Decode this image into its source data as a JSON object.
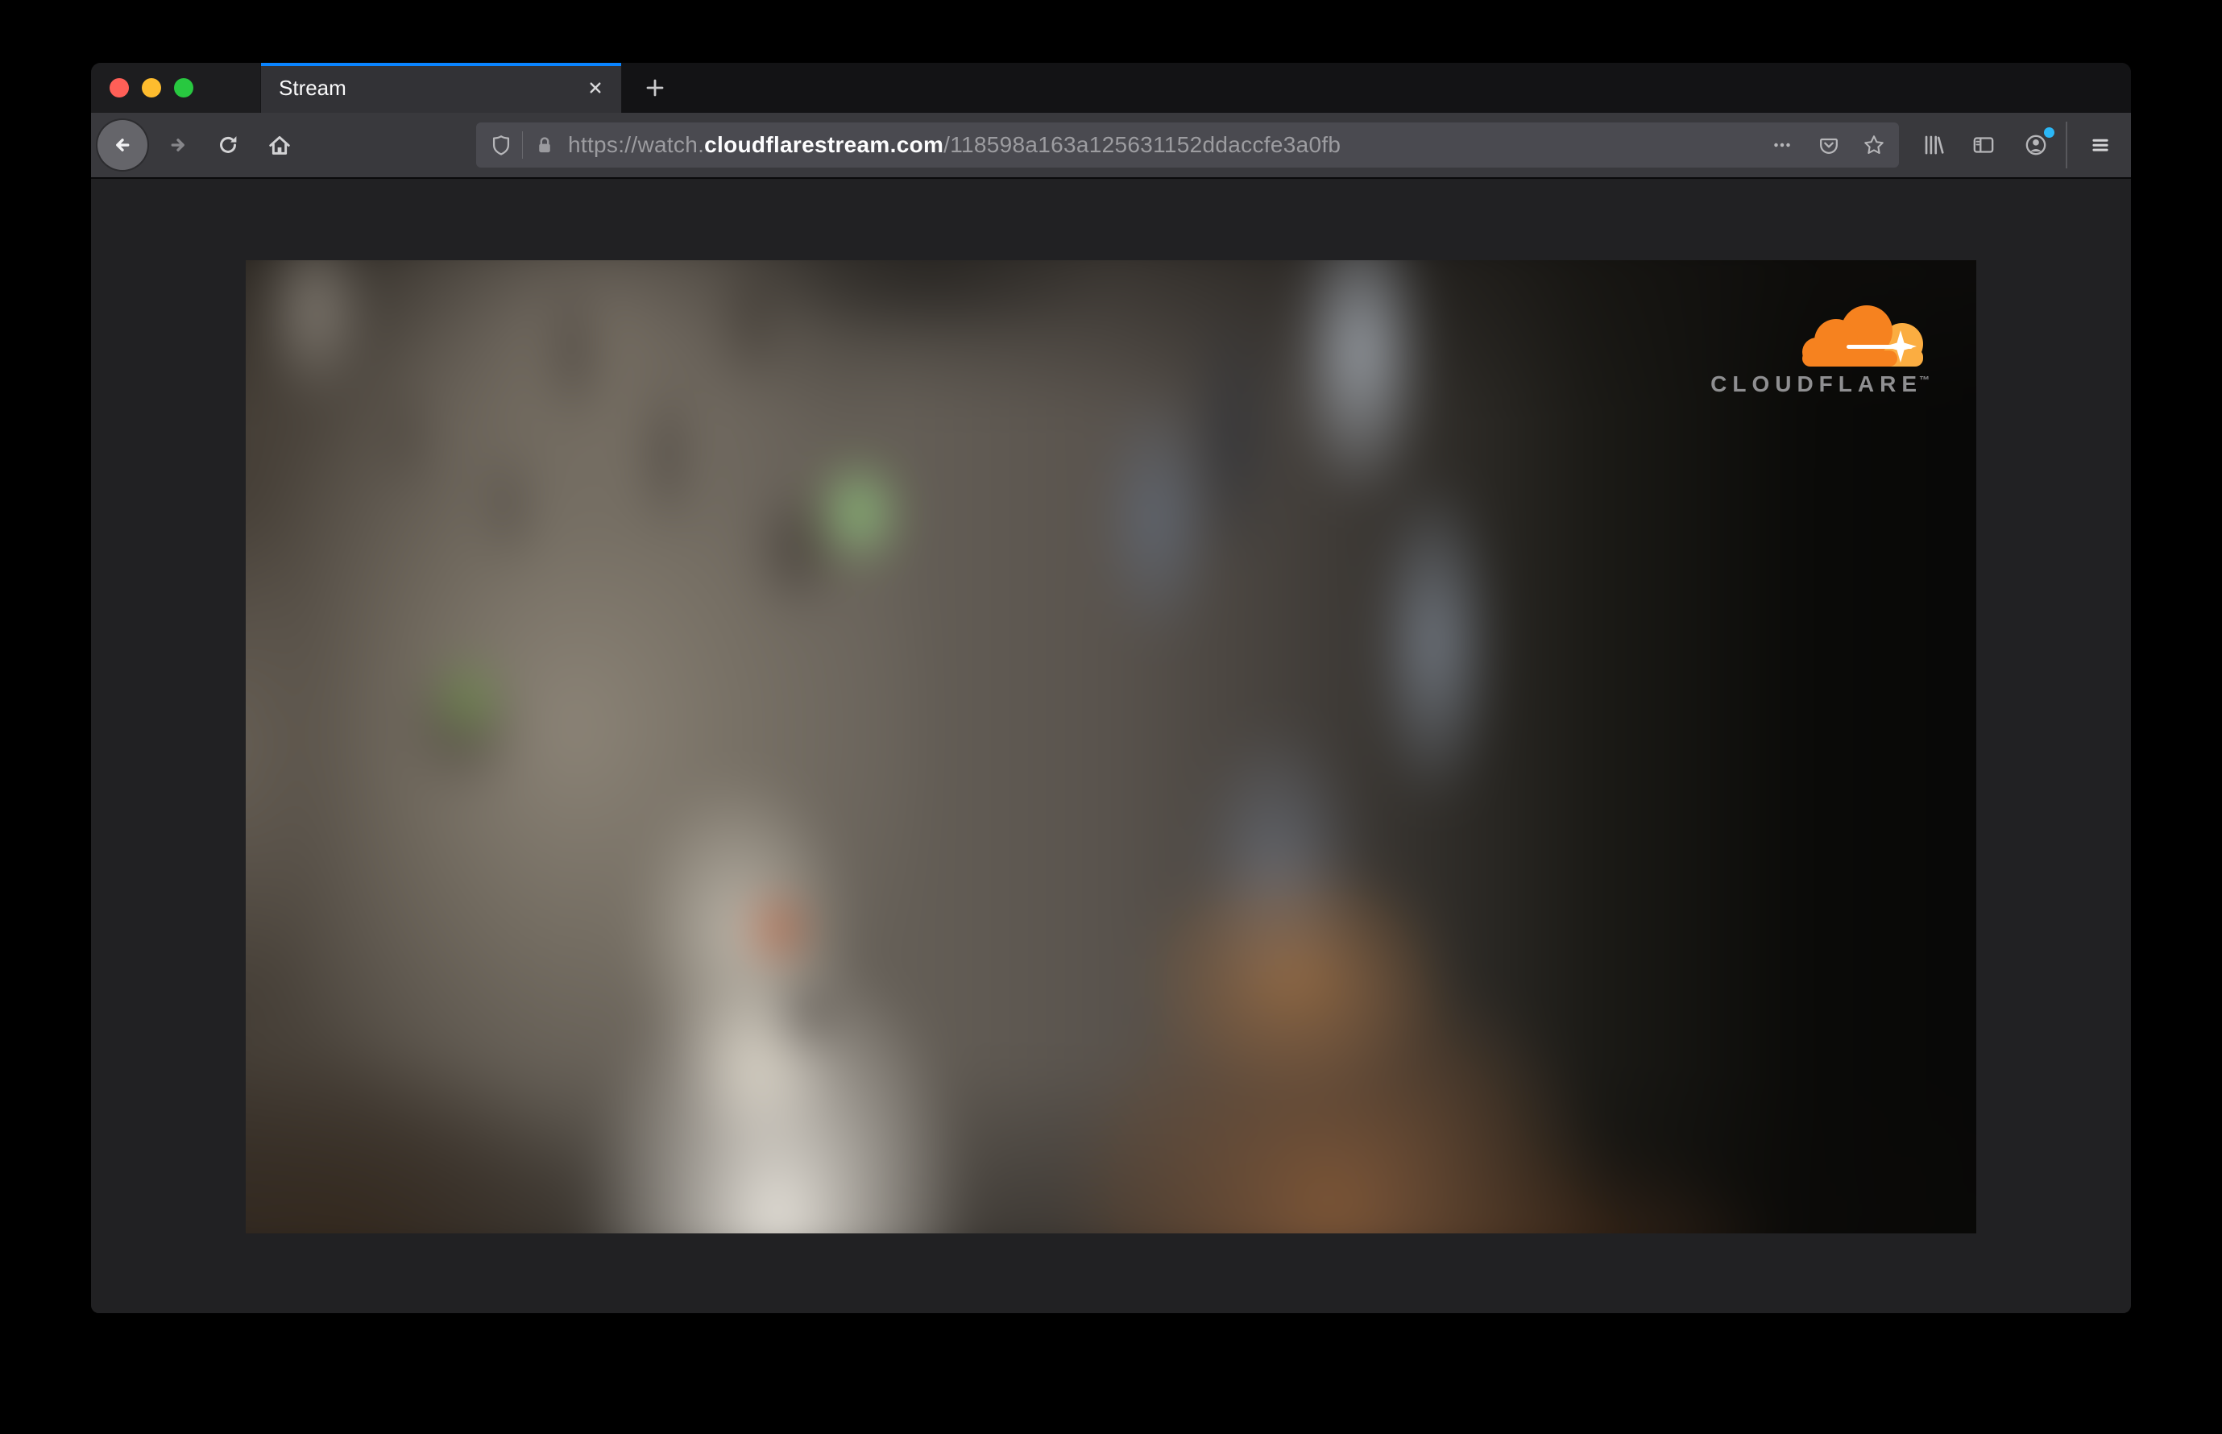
{
  "browser": {
    "tab": {
      "title": "Stream"
    },
    "address_bar": {
      "url_scheme": "https://watch.",
      "url_domain": "cloudflarestream.com",
      "url_path": "/118598a163a125631152ddaccfe3a0fb"
    }
  },
  "page": {
    "video_watermark": {
      "brand": "CLOUDFLARE",
      "trademark": "™"
    }
  },
  "colors": {
    "accent_blue": "#0a84ff",
    "notification_dot": "#2bb7f6",
    "traffic_red": "#ff5f57",
    "traffic_yellow": "#febc2e",
    "traffic_green": "#28c840",
    "cloudflare_orange": "#f6821f",
    "cloudflare_light_orange": "#fbad41",
    "cloudflare_text_grey": "#8f8f91"
  }
}
